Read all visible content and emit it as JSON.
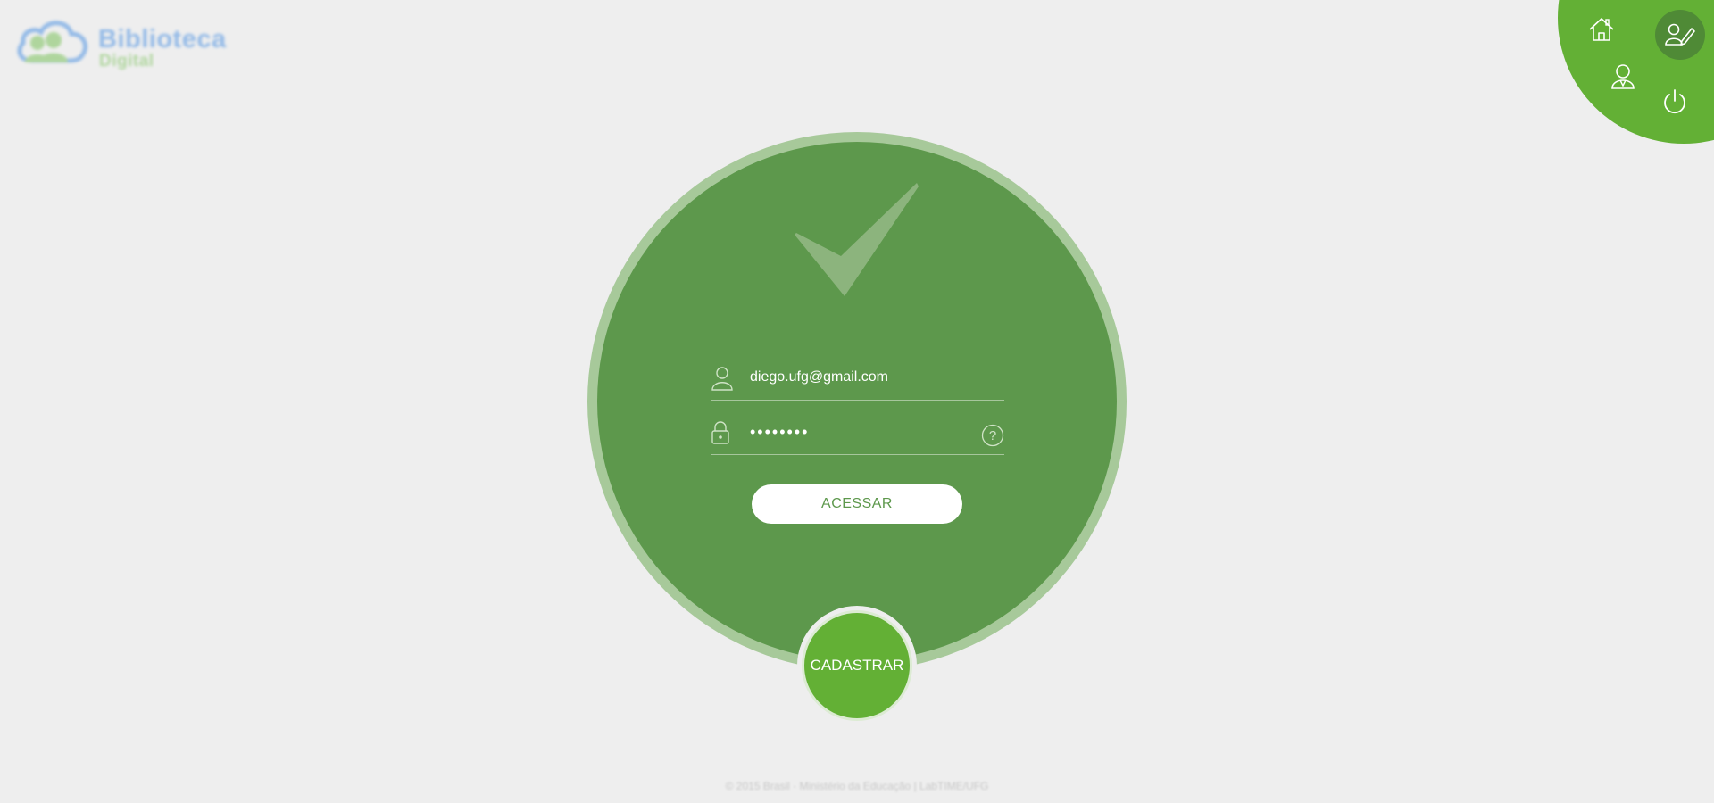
{
  "logo": {
    "title": "Biblioteca",
    "subtitle": "Digital",
    "icon": "cloud-people-icon"
  },
  "nav": {
    "items": [
      {
        "name": "home",
        "icon": "home-icon"
      },
      {
        "name": "edit",
        "icon": "edit-user-icon",
        "active": true
      },
      {
        "name": "user",
        "icon": "user-icon"
      },
      {
        "name": "power",
        "icon": "power-icon"
      }
    ]
  },
  "login": {
    "email_value": "diego.ufg@gmail.com",
    "password_value": "12345678",
    "submit_label": "ACESSAR"
  },
  "register": {
    "label": "CADASTRAR"
  },
  "footer": {
    "text": "© 2015 Brasil · Ministério da Educação | LabTIME/UFG"
  },
  "colors": {
    "page_bg": "#eeeeee",
    "accent_green": "#63b035",
    "circle_green": "#5d984c",
    "ring_green": "#a7c99a",
    "active_nav": "#4f8a36",
    "white": "#ffffff"
  }
}
